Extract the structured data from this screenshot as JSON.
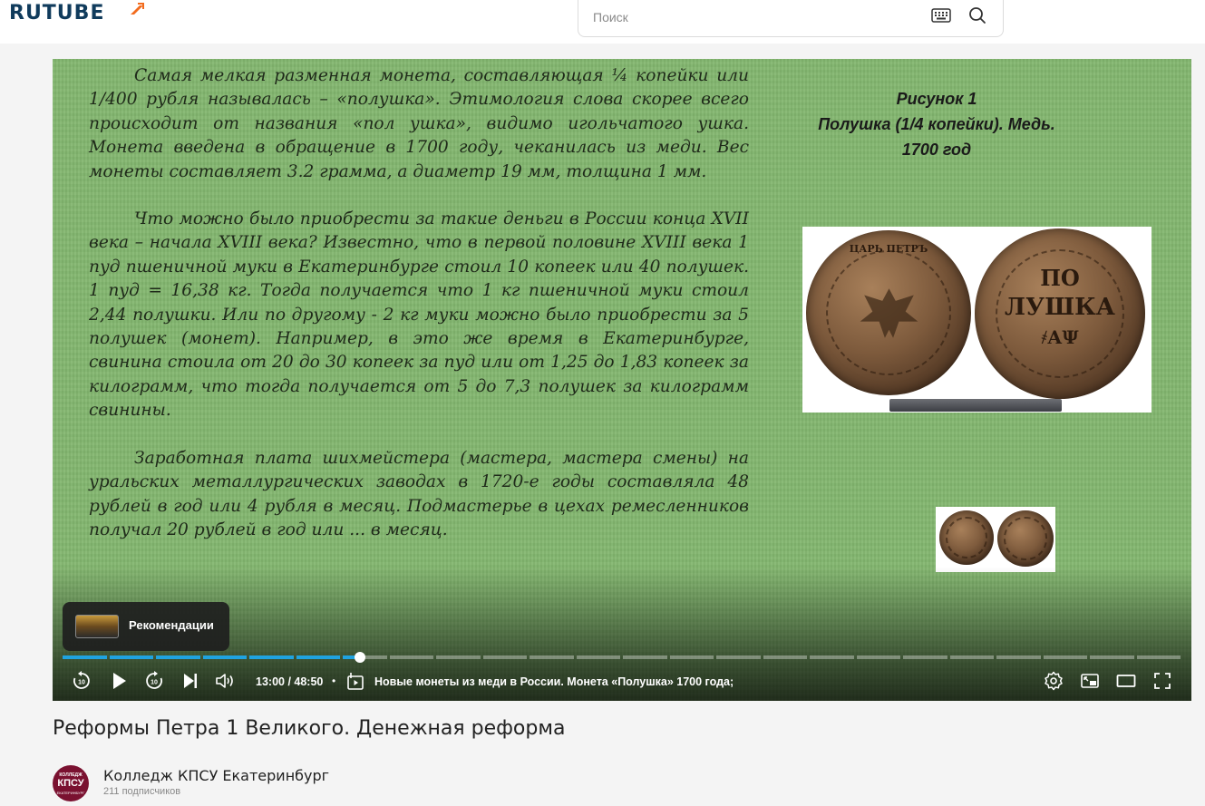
{
  "header": {
    "logo_text": "RUTUBE",
    "search_placeholder": "Поиск"
  },
  "slide": {
    "paragraphs": [
      "Самая мелкая разменная монета, составляющая ¼ копейки или 1/400 рубля называлась – «полушка». Этимология слова скорее всего происходит от названия «пол ушка», видимо игольчатого ушка. Монета введена в обращение в 1700 году, чеканилась из меди. Вес монеты составляет 3.2 грамма, а диаметр 19 мм, толщина 1 мм.",
      "Что можно было приобрести за такие деньги в России конца XVII века – начала XVIII века? Известно, что в первой половине XVIII века 1 пуд пшеничной муки в Екатеринбурге стоил 10 копеек или 40 полушек. 1 пуд = 16,38 кг. Тогда получается что 1 кг пшеничной муки стоил 2,44 полушки. Или по другому - 2 кг муки можно было приобрести за 5 полушек (монет). Например, в это же время в Екатеринбурге, свинина стоила от 20 до 30 копеек за пуд или от 1,25 до 1,83 копеек за килограмм, что тогда получается от 5 до 7,3 полушек за килограмм свинины.",
      "Заработная плата шихмейстера (мастера, мастера смены) на уральских металлургических заводах в 1720-е годы составляла 48 рублей в год или 4 рубля в месяц. Подмастерье в цехах ремесленников получал 20 рублей в год или ... в месяц."
    ],
    "figure_caption_1": "Рисунок 1",
    "figure_caption_2": "Полушка (1/4 копейки). Медь.",
    "figure_caption_3": "1700 год",
    "coin_obverse_legend": "ЦАРЬ ПЕТРЪ",
    "coin_reverse_line1": "ПО",
    "coin_reverse_line2": "ЛУШКА",
    "coin_reverse_line3": "҂АΨ"
  },
  "player": {
    "recommendations_label": "Рекомендации",
    "current_time": "13:00",
    "duration": "48:50",
    "time_separator": " / ",
    "chapter_title": "Новые монеты из меди в России. Монета «Полушка» 1700 года;",
    "progress": 0.266,
    "segment_count": 24,
    "played_segments": 7
  },
  "video": {
    "title": "Реформы Петра 1 Великого. Денежная реформа",
    "channel_name": "Колледж КПСУ Екатеринбург",
    "subscribers": "211 подписчиков",
    "avatar_top": "КОЛЛЕДЖ",
    "avatar_main": "КПСУ",
    "avatar_bottom": "ЕКАТЕРИНБУРГ"
  },
  "colors": {
    "accent": "#1fa3e0",
    "logo": "#103b5c",
    "logo_mark": "#f26b1d",
    "avatar": "#7a1130"
  },
  "icons": [
    "keyboard-icon",
    "search-icon",
    "rewind-10-icon",
    "play-icon",
    "forward-10-icon",
    "next-icon",
    "volume-icon",
    "chapters-icon",
    "settings-icon",
    "miniplayer-icon",
    "theater-icon",
    "fullscreen-icon"
  ]
}
